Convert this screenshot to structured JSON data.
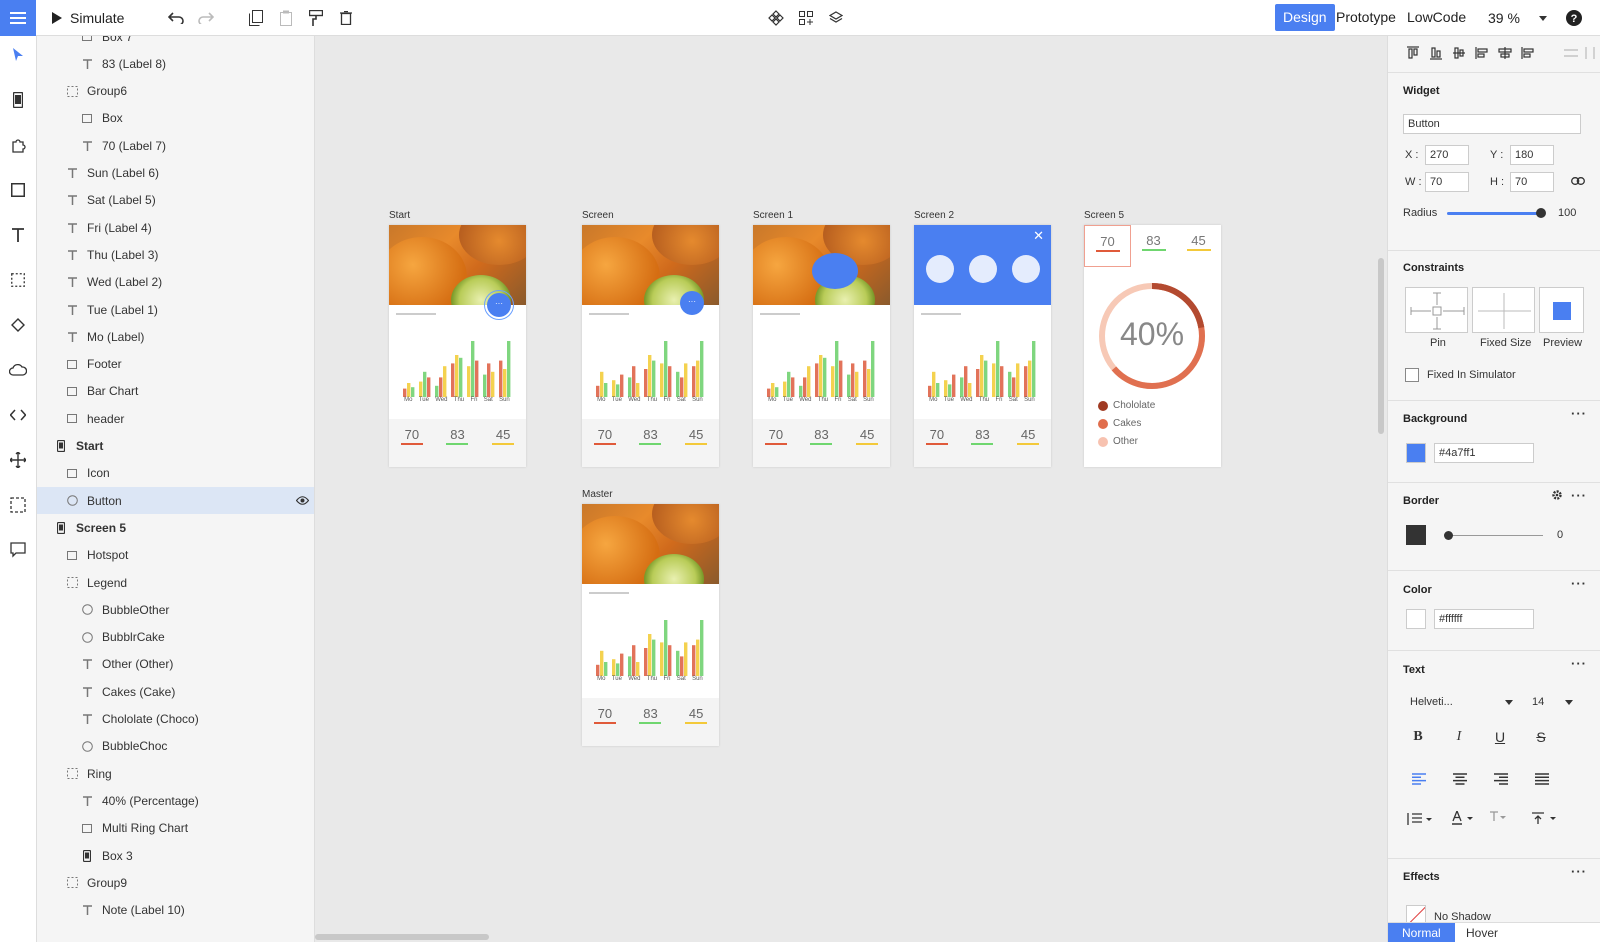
{
  "toolbar": {
    "simulate_label": "Simulate",
    "modes": [
      "Design",
      "Prototype",
      "LowCode"
    ],
    "zoom": "39 %"
  },
  "layers": {
    "items": [
      {
        "label": "Box 7",
        "icon": "box-icon",
        "depth": 2
      },
      {
        "label": "83 (Label 8)",
        "icon": "text-icon",
        "depth": 2
      },
      {
        "label": "Group6",
        "icon": "group-icon",
        "depth": 1
      },
      {
        "label": "Box",
        "icon": "box-icon",
        "depth": 2
      },
      {
        "label": "70 (Label 7)",
        "icon": "text-icon",
        "depth": 2
      },
      {
        "label": "Sun (Label 6)",
        "icon": "text-icon",
        "depth": 1
      },
      {
        "label": "Sat (Label 5)",
        "icon": "text-icon",
        "depth": 1
      },
      {
        "label": "Fri (Label 4)",
        "icon": "text-icon",
        "depth": 1
      },
      {
        "label": "Thu (Label 3)",
        "icon": "text-icon",
        "depth": 1
      },
      {
        "label": "Wed (Label 2)",
        "icon": "text-icon",
        "depth": 1
      },
      {
        "label": "Tue (Label 1)",
        "icon": "text-icon",
        "depth": 1
      },
      {
        "label": "Mo (Label)",
        "icon": "text-icon",
        "depth": 1
      },
      {
        "label": "Footer",
        "icon": "box-icon",
        "depth": 1
      },
      {
        "label": "Bar Chart",
        "icon": "box-icon",
        "depth": 1
      },
      {
        "label": "header",
        "icon": "box-icon",
        "depth": 1
      },
      {
        "label": "Start",
        "icon": "phone-icon",
        "depth": 0
      },
      {
        "label": "Icon",
        "icon": "box-icon",
        "depth": 1
      },
      {
        "label": "Button",
        "icon": "circle-icon",
        "depth": 1,
        "selected": true
      },
      {
        "label": "Screen 5",
        "icon": "phone-icon",
        "depth": 0
      },
      {
        "label": "Hotspot",
        "icon": "box-icon",
        "depth": 1
      },
      {
        "label": "Legend",
        "icon": "group-icon",
        "depth": 1
      },
      {
        "label": "BubbleOther",
        "icon": "circle-icon",
        "depth": 2
      },
      {
        "label": "BubblrCake",
        "icon": "circle-icon",
        "depth": 2
      },
      {
        "label": "Other (Other)",
        "icon": "text-icon",
        "depth": 2
      },
      {
        "label": "Cakes (Cake)",
        "icon": "text-icon",
        "depth": 2
      },
      {
        "label": "Chololate (Choco)",
        "icon": "text-icon",
        "depth": 2
      },
      {
        "label": "BubbleChoc",
        "icon": "circle-icon",
        "depth": 2
      },
      {
        "label": "Ring",
        "icon": "group-icon",
        "depth": 1
      },
      {
        "label": "40% (Percentage)",
        "icon": "text-icon",
        "depth": 2
      },
      {
        "label": "Multi Ring Chart",
        "icon": "box-icon",
        "depth": 2
      },
      {
        "label": "Box 3",
        "icon": "phone-icon",
        "depth": 2
      },
      {
        "label": "Group9",
        "icon": "group-icon",
        "depth": 1
      },
      {
        "label": "Note (Label 10)",
        "icon": "text-icon",
        "depth": 2
      }
    ]
  },
  "canvas": {
    "screens": [
      {
        "name": "Start"
      },
      {
        "name": "Screen"
      },
      {
        "name": "Screen 1"
      },
      {
        "name": "Screen 2"
      },
      {
        "name": "Screen 5"
      },
      {
        "name": "Master"
      }
    ],
    "days": [
      "Mo",
      "Tue",
      "Wed",
      "Thu",
      "Fri",
      "Sat",
      "Sun"
    ],
    "stats": [
      {
        "value": "70",
        "color": "#e05a3a"
      },
      {
        "value": "83",
        "color": "#6fd66f"
      },
      {
        "value": "45",
        "color": "#f3c93a"
      }
    ],
    "ring_value": "40%",
    "legend": [
      {
        "label": "Chololate",
        "color": "#a03a22"
      },
      {
        "label": "Cakes",
        "color": "#e06d4c"
      },
      {
        "label": "Other",
        "color": "#f7c2b0"
      }
    ]
  },
  "properties": {
    "widget_title": "Widget",
    "widget_name": "Button",
    "x": "270",
    "y": "180",
    "w": "70",
    "h": "70",
    "x_label": "X :",
    "y_label": "Y :",
    "w_label": "W :",
    "h_label": "H :",
    "radius_label": "Radius",
    "radius_value": "100",
    "constraints_title": "Constraints",
    "constraints_options": [
      "Pin",
      "Fixed Size",
      "Preview"
    ],
    "fixed_in_simulator": "Fixed In Simulator",
    "background_title": "Background",
    "background_hex": "#4a7ff1",
    "border_title": "Border",
    "border_value": "0",
    "color_title": "Color",
    "color_hex": "#ffffff",
    "text_title": "Text",
    "font": "Helveti...",
    "font_size": "14",
    "effects_title": "Effects",
    "effects_value": "No Shadow",
    "tabs": [
      "Normal",
      "Hover"
    ]
  },
  "colors": {
    "accent": "#4a7ff1"
  }
}
